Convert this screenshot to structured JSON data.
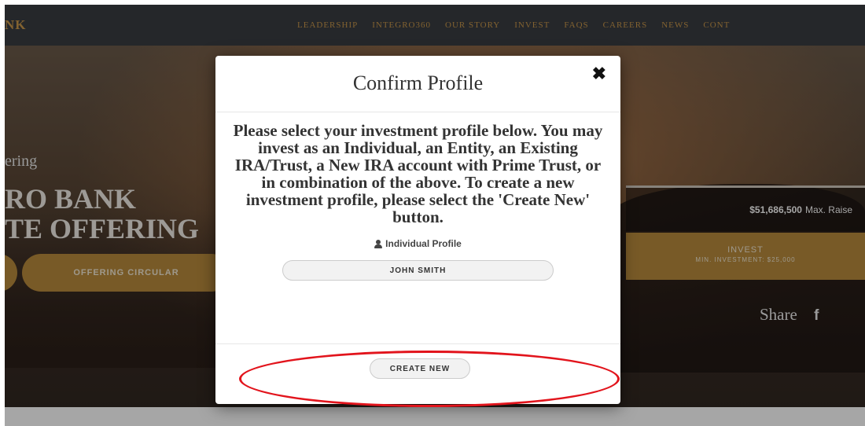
{
  "navbar": {
    "brand": "NK",
    "items": [
      "LEADERSHIP",
      "INTEGRO360",
      "OUR STORY",
      "INVEST",
      "FAQS",
      "CAREERS",
      "NEWS",
      "CONT"
    ]
  },
  "hero": {
    "offering": "ering",
    "title_line1": "RO BANK",
    "title_line2": "TE OFFERING",
    "offering_circular_button": "OFFERING CIRCULAR",
    "raise_amount": "$51,686,500",
    "raise_label": "Max. Raise",
    "invest_label": "INVEST",
    "invest_min": "MIN. INVESTMENT: $25,000",
    "share_label": "Share",
    "facebook_glyph": "f"
  },
  "modal": {
    "title": "Confirm Profile",
    "close_glyph": "✖",
    "message": "Please select your investment profile below. You may invest as an Individual, an Entity, an Existing IRA/Trust, a New IRA account with Prime Trust, or in combination of the above. To create a new investment profile, please select the 'Create New' button.",
    "profile_label": "Individual Profile",
    "profile_button": "JOHN SMITH",
    "create_button": "CREATE NEW"
  },
  "colors": {
    "gold": "#b88a3c",
    "annotation_red": "#e2141c"
  }
}
